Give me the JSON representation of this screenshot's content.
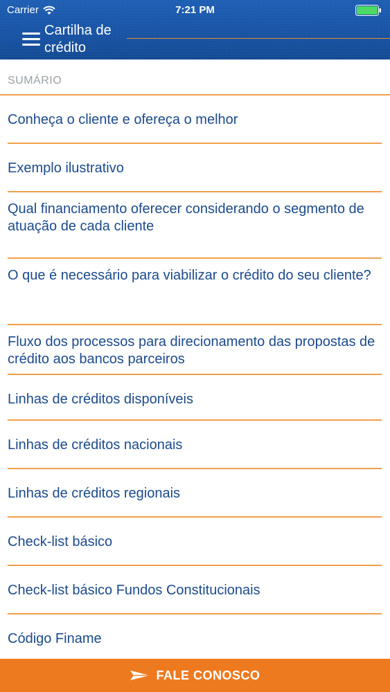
{
  "status_bar": {
    "carrier": "Carrier",
    "time": "7:21 PM"
  },
  "nav": {
    "title": "Cartilha de crédito",
    "menu_icon": "hamburger-menu-icon"
  },
  "section": {
    "header": "SUMÁRIO"
  },
  "items": [
    {
      "label": "Conheça o cliente e ofereça o melhor"
    },
    {
      "label": "Exemplo ilustrativo"
    },
    {
      "label": "Qual financiamento oferecer considerando o segmento de atuação de cada cliente"
    },
    {
      "label": "O que é necessário para viabilizar o crédito do seu cliente?"
    },
    {
      "label": "Fluxo dos processos para direcionamento das propostas de crédito aos bancos parceiros"
    },
    {
      "label": "Linhas de créditos disponíveis"
    },
    {
      "label": "Linhas de créditos nacionais"
    },
    {
      "label": "Linhas de créditos regionais"
    },
    {
      "label": "Check-list básico"
    },
    {
      "label": "Check-list básico Fundos Constitucionais"
    },
    {
      "label": "Código Finame"
    }
  ],
  "footer": {
    "label": "FALE CONOSCO",
    "icon": "paper-plane-icon"
  },
  "colors": {
    "header_blue": "#1a56a8",
    "accent_orange": "#ee7a1f",
    "divider_orange": "#f0a04a",
    "link_blue": "#1b4a8d",
    "section_gray": "#9aa0a6",
    "battery_green": "#4cd964"
  }
}
